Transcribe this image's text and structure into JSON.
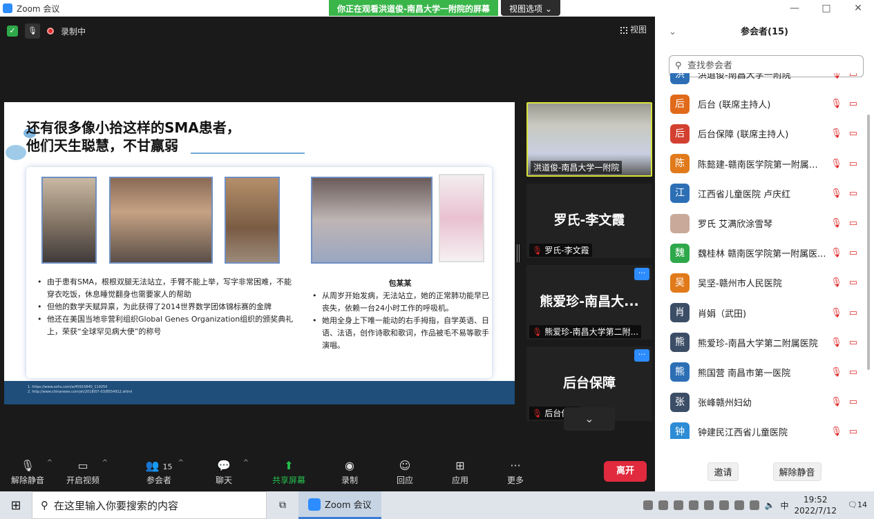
{
  "window": {
    "app_title": "Zoom 会议",
    "viewing_banner": "你正在观看洪道俊-南昌大学一附院的屏幕",
    "view_options": "视图选项",
    "controls": [
      "—",
      "□",
      "✕"
    ]
  },
  "meeting_top": {
    "recording_label": "录制中",
    "view_label": "视图"
  },
  "slide": {
    "title_line1": "还有很多像小拾这样的SMA患者，",
    "title_line2": "他们天生聪慧，不甘羸弱",
    "left_bullets": [
      "由于患有SMA，根根双腿无法站立，手臂不能上举，写字非常困难，不能穿衣吃饭，休息睡觉翻身也需要家人的帮助",
      "但他的数学天赋异禀，为此获得了2014世界数学团体锦标赛的金牌",
      "他还在美国当地非营利组织Global Genes Organization组织的颁奖典礼上，荣获“全球罕见病大使”的称号"
    ],
    "right_heading": "包某某",
    "right_bullets": [
      "从周岁开始发病，无法站立，她的正常肺功能早已丧失，依赖一台24小时工作的呼吸机。",
      "她用全身上下唯一能动的右手拇指，自学英语、日语、法语，创作诗歌和歌词，作品被毛不易等歌手演唱。"
    ],
    "references": [
      "1.   https://www.sohu.com/a/45915840_119250",
      "2.   http://www.chinanews.com/sh/2018/07-03/8554912.shtml"
    ]
  },
  "gallery": [
    {
      "name": "洪道俊-南昌大学一附院",
      "big_name": "",
      "active": true,
      "muted": false,
      "has_more": false
    },
    {
      "name": "罗氏-李文霞",
      "big_name": "罗氏-李文霞",
      "active": false,
      "muted": true,
      "has_more": false
    },
    {
      "name": "熊爱珍-南昌大学第二附...",
      "big_name": "熊爱珍-南昌大...",
      "active": false,
      "muted": true,
      "has_more": true
    },
    {
      "name": "后台保障",
      "big_name": "后台保障",
      "active": false,
      "muted": true,
      "has_more": true
    }
  ],
  "toolbar": {
    "unmute": "解除静音",
    "start_video": "开启视频",
    "participants": "参会者",
    "participants_count": "15",
    "chat": "聊天",
    "share_screen": "共享屏幕",
    "record": "录制",
    "reactions": "回应",
    "apps": "应用",
    "more": "更多",
    "leave": "离开"
  },
  "participants_panel": {
    "title": "参会者(15)",
    "search_placeholder": "查找参会者",
    "participants": [
      {
        "avatar": "洪",
        "color": "#2d6fb5",
        "name": "洪道俊-南昌大学一附院"
      },
      {
        "avatar": "后",
        "color": "#e06a1a",
        "name": "后台 (联席主持人)"
      },
      {
        "avatar": "后",
        "color": "#d34030",
        "name": "后台保障 (联席主持人)"
      },
      {
        "avatar": "陈",
        "color": "#e07a1a",
        "name": "陈懿建-赣南医学院第一附属医..."
      },
      {
        "avatar": "江",
        "color": "#2d6fb5",
        "name": "江西省儿童医院 卢庆红"
      },
      {
        "avatar": "",
        "color": "#c9a99a",
        "name": "罗氏 艾满欣涂雪琴"
      },
      {
        "avatar": "魏",
        "color": "#2ea84a",
        "name": "魏桂林  赣南医学院第一附属医..."
      },
      {
        "avatar": "吴",
        "color": "#e07a1a",
        "name": "吴坚-赣州市人民医院"
      },
      {
        "avatar": "肖",
        "color": "#3c4d66",
        "name": "肖娟（武田)"
      },
      {
        "avatar": "熊",
        "color": "#3c4d66",
        "name": "熊爱珍-南昌大学第二附属医院"
      },
      {
        "avatar": "熊",
        "color": "#2d6fb5",
        "name": "熊国营  南昌市第一医院"
      },
      {
        "avatar": "张",
        "color": "#3c4d66",
        "name": "张峰赣州妇幼"
      },
      {
        "avatar": "钟",
        "color": "#2d8cd5",
        "name": "钟建民江西省儿童医院"
      }
    ],
    "invite": "邀请",
    "unmute_all": "解除静音"
  },
  "taskbar": {
    "search_placeholder": "在这里输入你要搜索的内容",
    "zoom_app": "Zoom 会议",
    "ime": "中",
    "time": "19:52",
    "date": "2022/7/12",
    "notifications": "14"
  }
}
